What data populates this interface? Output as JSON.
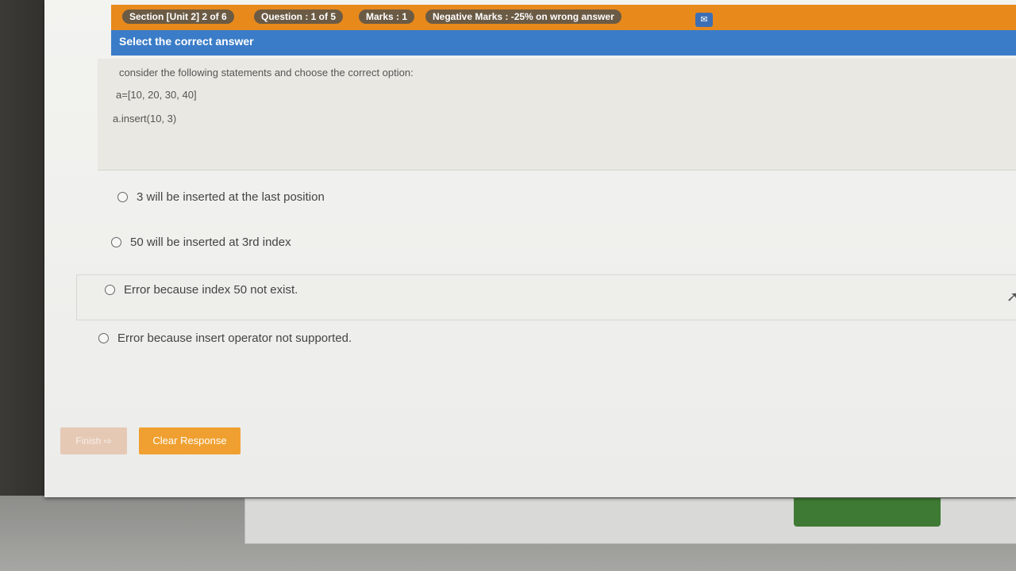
{
  "header": {
    "section": "Section [Unit 2] 2 of 6",
    "question": "Question : 1 of 5",
    "marks": "Marks : 1",
    "negative": "Negative Marks : -25% on wrong answer"
  },
  "instruction": "Select the correct answer",
  "question": {
    "prompt": "consider the following statements and choose the correct option:",
    "line1": "a=[10, 20, 30, 40]",
    "line2": "a.insert(10, 3)"
  },
  "options": [
    "3 will be inserted at the last position",
    "50 will be inserted at 3rd index",
    "Error because index 50 not exist.",
    "Error because insert operator not supported."
  ],
  "buttons": {
    "finish": "Finish ⇨",
    "clear": "Clear Response"
  },
  "icons": {
    "chat": "chat-icon",
    "cursor": "mouse-pointer-icon"
  },
  "colors": {
    "topbar": "#e8891c",
    "instruction_bar": "#3a7cc8",
    "clear_button": "#f0a030"
  }
}
